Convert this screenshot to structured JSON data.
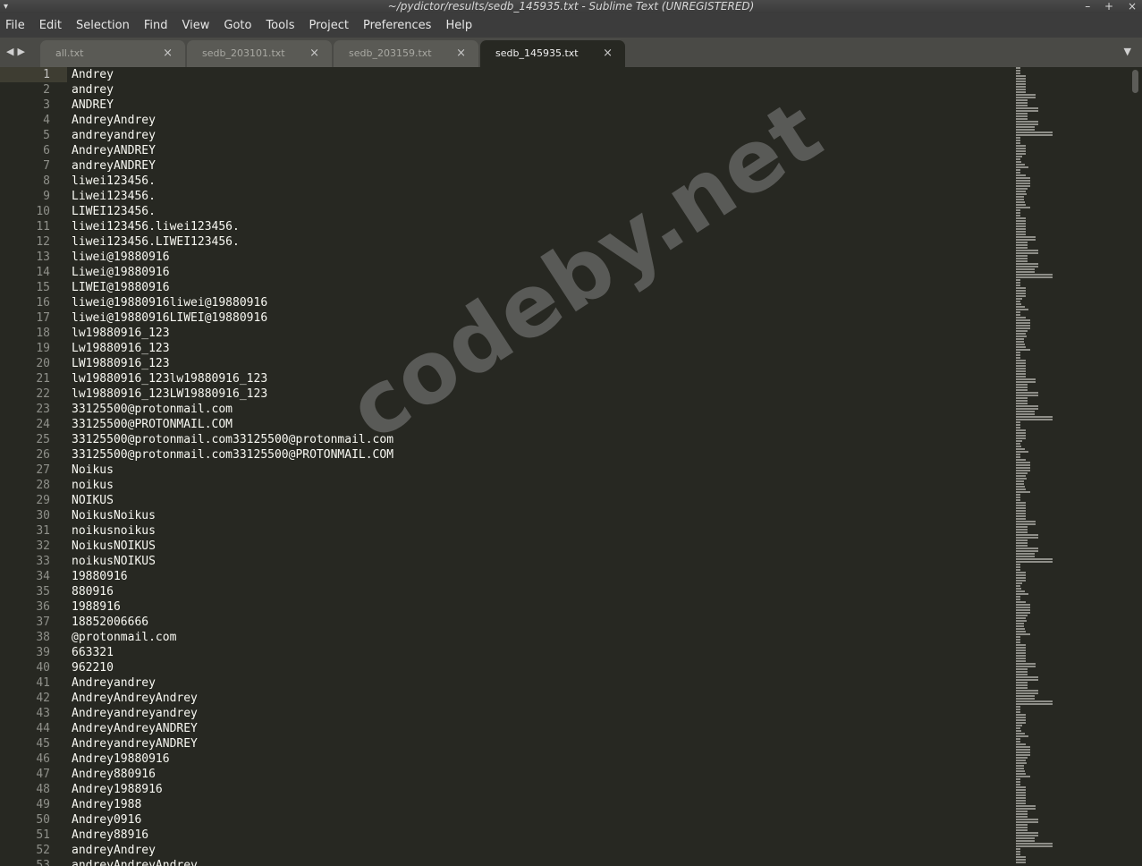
{
  "window": {
    "title": "~/pydictor/results/sedb_145935.txt - Sublime Text (UNREGISTERED)",
    "controls": [
      "–",
      "+",
      "×"
    ]
  },
  "menu": [
    "File",
    "Edit",
    "Selection",
    "Find",
    "View",
    "Goto",
    "Tools",
    "Project",
    "Preferences",
    "Help"
  ],
  "tabs": [
    {
      "label": "all.txt",
      "active": false
    },
    {
      "label": "sedb_203101.txt",
      "active": false
    },
    {
      "label": "sedb_203159.txt",
      "active": false
    },
    {
      "label": "sedb_145935.txt",
      "active": true
    }
  ],
  "icons": {
    "nav_back": "◀",
    "nav_forward": "▶",
    "close": "×",
    "dropdown": "▼",
    "window_menu": "▾"
  },
  "editor": {
    "current_line": 1,
    "lines": [
      "Andrey",
      "andrey",
      "ANDREY",
      "AndreyAndrey",
      "andreyandrey",
      "AndreyANDREY",
      "andreyANDREY",
      "liwei123456.",
      "Liwei123456.",
      "LIWEI123456.",
      "liwei123456.liwei123456.",
      "liwei123456.LIWEI123456.",
      "liwei@19880916",
      "Liwei@19880916",
      "LIWEI@19880916",
      "liwei@19880916liwei@19880916",
      "liwei@19880916LIWEI@19880916",
      "lw19880916_123",
      "Lw19880916_123",
      "LW19880916_123",
      "lw19880916_123lw19880916_123",
      "lw19880916_123LW19880916_123",
      "33125500@protonmail.com",
      "33125500@PROTONMAIL.COM",
      "33125500@protonmail.com33125500@protonmail.com",
      "33125500@protonmail.com33125500@PROTONMAIL.COM",
      "Noikus",
      "noikus",
      "NOIKUS",
      "NoikusNoikus",
      "noikusnoikus",
      "NoikusNOIKUS",
      "noikusNOIKUS",
      "19880916",
      "880916",
      "1988916",
      "18852006666",
      "@protonmail.com",
      "663321",
      "962210",
      "Andreyandrey",
      "AndreyAndreyAndrey",
      "Andreyandreyandrey",
      "AndreyAndreyANDREY",
      "AndreyandreyANDREY",
      "Andrey19880916",
      "Andrey880916",
      "Andrey1988916",
      "Andrey1988",
      "Andrey0916",
      "Andrey88916",
      "andreyAndrey",
      "andreyAndreyAndrey"
    ]
  },
  "watermark": "codeby.net",
  "colors": {
    "background": "#272822",
    "text": "#f8f8f2",
    "gutter_text": "#8f908a",
    "tabbar": "#4a4a46"
  }
}
